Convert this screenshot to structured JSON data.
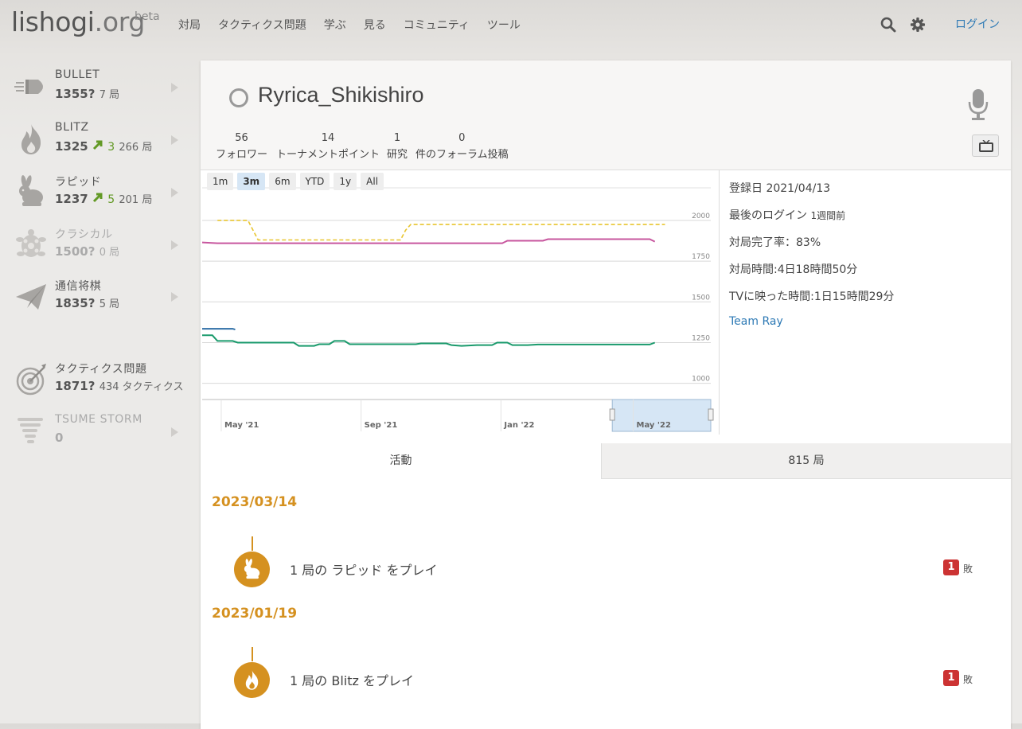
{
  "header": {
    "logo_main": "lishogi",
    "logo_tld": ".org",
    "logo_beta": "beta",
    "nav": [
      "対局",
      "タクティクス問題",
      "学ぶ",
      "見る",
      "コミュニティ",
      "ツール"
    ],
    "search_icon": "search-icon",
    "settings_icon": "gear-icon",
    "login_label": "ログイン"
  },
  "sidebar": {
    "perfs": [
      {
        "name": "BULLET",
        "rating": "1355?",
        "progress": "",
        "count": "7 局",
        "icon": "bullet-icon",
        "dim": false
      },
      {
        "name": "BLITZ",
        "rating": "1325",
        "progress": "3",
        "count": "266 局",
        "icon": "fire-icon",
        "dim": false
      },
      {
        "name": "ラピッド",
        "rating": "1237",
        "progress": "5",
        "count": "201 局",
        "icon": "rabbit-icon",
        "dim": false
      },
      {
        "name": "クラシカル",
        "rating": "1500?",
        "progress": "",
        "count": "0 局",
        "icon": "turtle-icon",
        "dim": true
      },
      {
        "name": "通信将棋",
        "rating": "1835?",
        "progress": "",
        "count": "5 局",
        "icon": "paper-plane-icon",
        "dim": false
      },
      {
        "name": "タクティクス問題",
        "rating": "1871?",
        "progress": "",
        "count": "434 タクティクス",
        "icon": "target-icon",
        "dim": false
      },
      {
        "name": "TSUME STORM",
        "rating": "0",
        "progress": "",
        "count": "",
        "icon": "tornado-icon",
        "dim": true
      }
    ]
  },
  "profile": {
    "username": "Ryrica_Shikishiro",
    "status_icon": "offline-ring-icon",
    "mic_icon": "microphone-icon",
    "tv_icon": "tv-icon",
    "stats": [
      {
        "num": "56",
        "label": "フォロワー"
      },
      {
        "num": "14",
        "label": "トーナメントポイント"
      },
      {
        "num": "1",
        "label": "研究"
      },
      {
        "num": "0",
        "label": "件のフォーラム投稿"
      }
    ]
  },
  "info": {
    "joined": "登録日 2021/04/13",
    "last_login_label": "最後のログイン",
    "last_login_value": "1週間前",
    "completion": "対局完了率：83%",
    "playtime": "対局時間:4日18時間50分",
    "tv_time": "TVに映った時間:1日15時間29分",
    "team": "Team Ray"
  },
  "chart_data": {
    "type": "line",
    "range_buttons": [
      "1m",
      "3m",
      "6m",
      "YTD",
      "1y",
      "All"
    ],
    "selected_range": "3m",
    "y_ticks": [
      2000,
      1750,
      1500,
      1250,
      1000
    ],
    "ylim": [
      930,
      2200
    ],
    "x_ticks": [
      {
        "label": "May '21",
        "t": 0.05
      },
      {
        "label": "Sep '21",
        "t": 0.325
      },
      {
        "label": "Jan '22",
        "t": 0.6
      },
      {
        "label": "May '22",
        "t": 0.86
      }
    ],
    "colors": {
      "correspondence": "#e8c52f",
      "puzzle": "#c7569e",
      "bullet": "#2e6ea6",
      "blitz_rapid": "#1a9a6c"
    },
    "series": [
      {
        "style": "dashed",
        "color": "#e8c52f",
        "points": [
          [
            0.03,
            2000
          ],
          [
            0.09,
            2000
          ],
          [
            0.1,
            1940
          ],
          [
            0.11,
            1880
          ],
          [
            0.39,
            1880
          ],
          [
            0.4,
            1940
          ],
          [
            0.41,
            1975
          ],
          [
            0.91,
            1975
          ]
        ]
      },
      {
        "style": "solid",
        "color": "#c7569e",
        "points": [
          [
            0.0,
            1865
          ],
          [
            0.03,
            1860
          ],
          [
            0.59,
            1860
          ],
          [
            0.6,
            1875
          ],
          [
            0.67,
            1875
          ],
          [
            0.68,
            1885
          ],
          [
            0.88,
            1885
          ],
          [
            0.89,
            1870
          ]
        ]
      },
      {
        "style": "solid",
        "color": "#2e6ea6",
        "points": [
          [
            0.0,
            1335
          ],
          [
            0.06,
            1335
          ],
          [
            0.065,
            1330
          ]
        ]
      },
      {
        "style": "solid",
        "color": "#1a9a6c",
        "points": [
          [
            0.0,
            1295
          ],
          [
            0.02,
            1295
          ],
          [
            0.03,
            1260
          ],
          [
            0.06,
            1260
          ],
          [
            0.07,
            1250
          ],
          [
            0.18,
            1250
          ],
          [
            0.19,
            1230
          ],
          [
            0.22,
            1230
          ],
          [
            0.23,
            1240
          ],
          [
            0.25,
            1240
          ],
          [
            0.26,
            1260
          ],
          [
            0.28,
            1260
          ],
          [
            0.29,
            1240
          ],
          [
            0.42,
            1240
          ],
          [
            0.43,
            1245
          ],
          [
            0.48,
            1245
          ],
          [
            0.49,
            1235
          ],
          [
            0.51,
            1230
          ],
          [
            0.54,
            1235
          ],
          [
            0.57,
            1235
          ],
          [
            0.58,
            1250
          ],
          [
            0.6,
            1250
          ],
          [
            0.61,
            1235
          ],
          [
            0.64,
            1235
          ],
          [
            0.66,
            1238
          ],
          [
            0.88,
            1238
          ],
          [
            0.89,
            1250
          ]
        ]
      }
    ],
    "navigator_window": [
      0.8,
      1.0
    ]
  },
  "tabs": {
    "activity": "活動",
    "games": "815 局"
  },
  "activity": [
    {
      "date": "2023/03/14",
      "text": "1 局の ラピッド をプレイ",
      "badge": "1",
      "result": "敗",
      "icon": "rabbit-icon"
    },
    {
      "date": "2023/01/19",
      "text": "1 局の Blitz をプレイ",
      "badge": "1",
      "result": "敗",
      "icon": "fire-icon"
    }
  ]
}
